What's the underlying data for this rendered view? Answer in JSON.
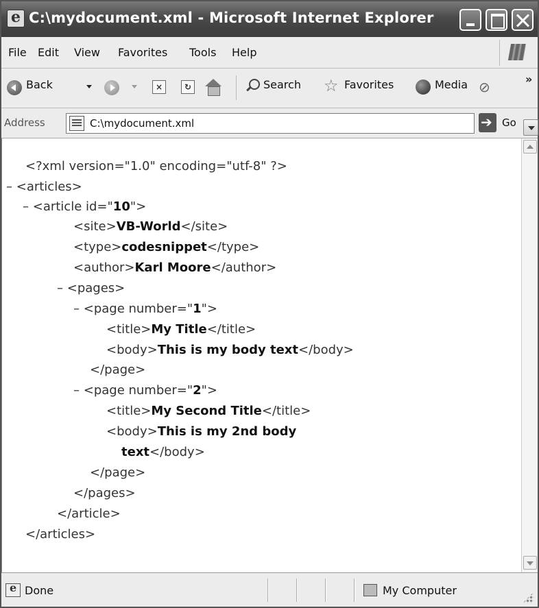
{
  "window": {
    "title": "C:\\mydocument.xml - Microsoft Internet Explorer"
  },
  "menu": {
    "items": [
      "File",
      "Edit",
      "View",
      "Favorites",
      "Tools",
      "Help"
    ]
  },
  "toolbar": {
    "back_label": "Back",
    "search_label": "Search",
    "favorites_label": "Favorites",
    "media_label": "Media",
    "more_label": "»"
  },
  "address": {
    "label": "Address",
    "value": "C:\\mydocument.xml",
    "go_label": "Go"
  },
  "xml": {
    "declaration": "<?xml version=\"1.0\" encoding=\"utf-8\" ?>",
    "minus": "–",
    "articles_open": "<articles>",
    "article_open_pre": "<article id=\"",
    "article_id": "10",
    "article_open_post": "\">",
    "site_open": "<site>",
    "site_value": "VB-World",
    "site_close": "</site>",
    "type_open": "<type>",
    "type_value": "codesnippet",
    "type_close": "</type>",
    "author_open": "<author>",
    "author_value": "Karl Moore",
    "author_close": "</author>",
    "pages_open": "<pages>",
    "page_open_pre": "<page number=\"",
    "page1_number": "1",
    "page_open_post": "\">",
    "title_open": "<title>",
    "page1_title": "My Title",
    "title_close": "</title>",
    "body_open": "<body>",
    "page1_body": "This is my body text",
    "body_close": "</body>",
    "page_close": "</page>",
    "page2_number": "2",
    "page2_title": "My Second Title",
    "page2_body_line1": "This is my 2nd body",
    "page2_body_line2": "text",
    "pages_close": "</pages>",
    "article_close": "</article>",
    "articles_close": "</articles>"
  },
  "status": {
    "text": "Done",
    "zone": "My Computer"
  },
  "colors": {
    "titlebar": "#4a4a4a",
    "chrome": "#ececec"
  }
}
